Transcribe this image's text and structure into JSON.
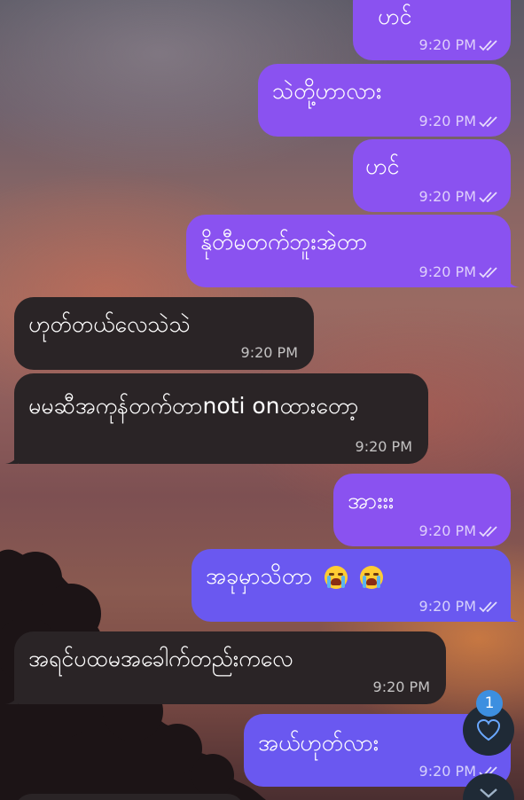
{
  "messages": [
    {
      "text": "ဟင်",
      "time": "9:20 PM"
    },
    {
      "text": "သဲတို့ဟာလား",
      "time": "9:20 PM"
    },
    {
      "text": "ဟင်",
      "time": "9:20 PM"
    },
    {
      "text": "နိုတီမတက်ဘူးအဲတာ",
      "time": "9:20 PM"
    },
    {
      "text": "ဟုတ်တယ်လေသဲသဲ",
      "time": "9:20 PM"
    },
    {
      "text": "မမဆီအကုန်တက်တာnoti onထားတော့",
      "time": "9:20 PM"
    },
    {
      "text": "အားးး",
      "time": "9:20 PM"
    },
    {
      "text": "အခုမှာသိတာ",
      "time": "9:20 PM"
    },
    {
      "text": "အရင်ပထမအခေါက်တည်းကလေ",
      "time": "9:20 PM"
    },
    {
      "text": "အယ်ဟုတ်လား",
      "time": "9:20 PM"
    }
  ],
  "reactions": {
    "count": "1"
  },
  "icons": {
    "read": "double-check-icon",
    "reaction": "heart-icon",
    "scroll": "chevron-down-icon",
    "emoji": "loudly-crying-face-icon"
  },
  "colors": {
    "outgoing": "#8a52f0",
    "outgoing_alt": "#6a58f0",
    "incoming": "#2a2426",
    "badge": "#3d8fe0"
  }
}
